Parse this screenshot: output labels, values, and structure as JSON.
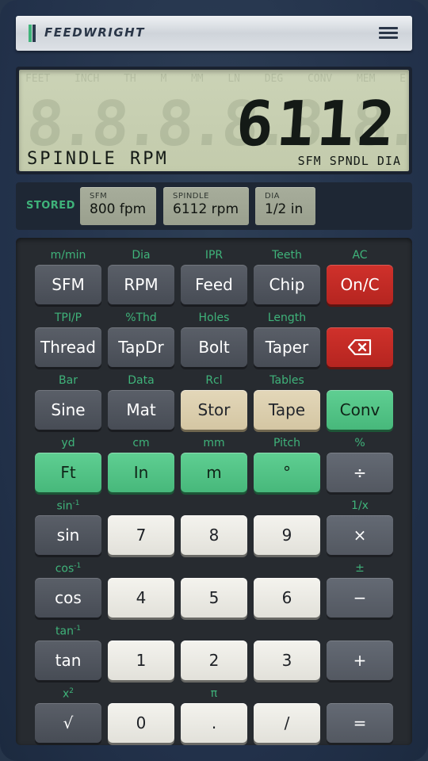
{
  "header": {
    "brand": "FEEDWRIGHT",
    "brand_colors": {
      "accent_green": "#3fb37a",
      "accent_dark": "#2b3a4e"
    },
    "menu_icon": "hamburger-menu-icon"
  },
  "display": {
    "value": "6112",
    "ghost_digits": "8.8.8.8.8.8.8.8.8.",
    "label": "SPINDLE RPM",
    "flags": "SFM SPNDL DIA",
    "ghost_annunciators": [
      "FEET",
      "INCH",
      "TH",
      "M",
      "MM",
      "LN",
      "DEG",
      "CONV",
      "MEM",
      "E"
    ]
  },
  "stored": {
    "label": "STORED",
    "items": [
      {
        "key": "SFM",
        "value": "800 fpm"
      },
      {
        "key": "SPINDLE",
        "value": "6112 rpm"
      },
      {
        "key": "DIA",
        "value": "1/2 in"
      }
    ]
  },
  "keypad": {
    "rows": [
      [
        {
          "shift": "m/min",
          "label": "SFM",
          "style": "dark"
        },
        {
          "shift": "Dia",
          "label": "RPM",
          "style": "dark"
        },
        {
          "shift": "IPR",
          "label": "Feed",
          "style": "dark"
        },
        {
          "shift": "Teeth",
          "label": "Chip",
          "style": "dark"
        },
        {
          "shift": "AC",
          "label": "On/C",
          "style": "red"
        }
      ],
      [
        {
          "shift": "TPI/P",
          "label": "Thread",
          "style": "dark"
        },
        {
          "shift": "%Thd",
          "label": "TapDr",
          "style": "dark"
        },
        {
          "shift": "Holes",
          "label": "Bolt",
          "style": "dark"
        },
        {
          "shift": "Length",
          "label": "Taper",
          "style": "dark"
        },
        {
          "shift": "",
          "label": "",
          "icon": "backspace-icon",
          "style": "red"
        }
      ],
      [
        {
          "shift": "Bar",
          "label": "Sine",
          "style": "dark"
        },
        {
          "shift": "Data",
          "label": "Mat",
          "style": "dark"
        },
        {
          "shift": "Rcl",
          "label": "Stor",
          "style": "beige"
        },
        {
          "shift": "Tables",
          "label": "Tape",
          "style": "beige"
        },
        {
          "shift": "",
          "label": "Conv",
          "style": "green"
        }
      ],
      [
        {
          "shift": "yd",
          "label": "Ft",
          "style": "green"
        },
        {
          "shift": "cm",
          "label": "In",
          "style": "green"
        },
        {
          "shift": "mm",
          "label": "m",
          "style": "green"
        },
        {
          "shift": "Pitch",
          "label": "°",
          "style": "green"
        },
        {
          "shift": "%",
          "label": "÷",
          "style": "op"
        }
      ],
      [
        {
          "shift": "sin",
          "shift_sup": "-1",
          "label": "sin",
          "style": "dark"
        },
        {
          "shift": "",
          "label": "7",
          "style": "white"
        },
        {
          "shift": "",
          "label": "8",
          "style": "white"
        },
        {
          "shift": "",
          "label": "9",
          "style": "white"
        },
        {
          "shift": "1/x",
          "label": "×",
          "style": "op"
        }
      ],
      [
        {
          "shift": "cos",
          "shift_sup": "-1",
          "label": "cos",
          "style": "dark"
        },
        {
          "shift": "",
          "label": "4",
          "style": "white"
        },
        {
          "shift": "",
          "label": "5",
          "style": "white"
        },
        {
          "shift": "",
          "label": "6",
          "style": "white"
        },
        {
          "shift": "±",
          "label": "−",
          "style": "op"
        }
      ],
      [
        {
          "shift": "tan",
          "shift_sup": "-1",
          "label": "tan",
          "style": "dark"
        },
        {
          "shift": "",
          "label": "1",
          "style": "white"
        },
        {
          "shift": "",
          "label": "2",
          "style": "white"
        },
        {
          "shift": "",
          "label": "3",
          "style": "white"
        },
        {
          "shift": "",
          "label": "+",
          "style": "op"
        }
      ],
      [
        {
          "shift": "x",
          "shift_sup": "2",
          "label": "√",
          "style": "dark"
        },
        {
          "shift": "",
          "label": "0",
          "style": "white"
        },
        {
          "shift": "π",
          "label": ".",
          "style": "white"
        },
        {
          "shift": "",
          "label": "/",
          "style": "white"
        },
        {
          "shift": "",
          "label": "=",
          "style": "op"
        }
      ]
    ]
  },
  "colors": {
    "body": "#26354a",
    "lcd": "#c7cfb1",
    "accent_green": "#3fb37a",
    "red_key": "#c22b25",
    "beige_key": "#dccfb0",
    "green_key": "#52c486"
  }
}
